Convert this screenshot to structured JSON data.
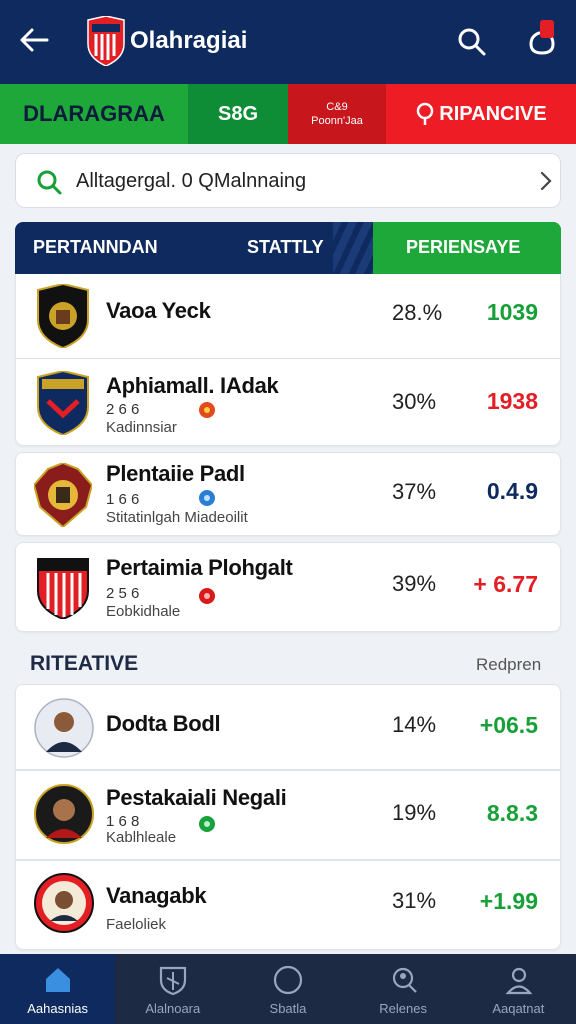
{
  "header": {
    "title": "Olahragiai",
    "icons": [
      "back-arrow-icon",
      "team-crest-logo",
      "search-icon",
      "notification-bell-icon"
    ]
  },
  "banner": {
    "seg1": "DLARAGRAA",
    "seg2": "S8G",
    "seg3_line1": "C&9",
    "seg3_line2": "Poonn'Jaa",
    "seg4": "RIPANCIVE"
  },
  "search": {
    "text": "Alltagergal. 0 QMalnnaing"
  },
  "table_header": {
    "col1": "PERTANNDAN",
    "col2": "STATTLY",
    "col3": "PERIENSAYE"
  },
  "teams": [
    {
      "name": "Vaoa Yeck",
      "stats": "",
      "sub": "",
      "pct": "28.%",
      "value": "1039",
      "value_color": "green"
    },
    {
      "name": "Aphiamall. IAdak",
      "stats": "2 6 6",
      "sub": "Kadinnsiar",
      "pct": "30%",
      "value": "1938",
      "value_color": "red"
    },
    {
      "name": "Plentaiie Padl",
      "stats": "1 6 6",
      "sub": "Stitatinlgah  Miadeoilit",
      "pct": "37%",
      "value": "0.4.9",
      "value_color": "navy"
    },
    {
      "name": "Pertaimia Plohgalt",
      "stats": "2 5 6",
      "sub": "Eobkidhale",
      "pct": "39%",
      "value": "+ 6.77",
      "value_color": "red"
    }
  ],
  "section": {
    "title": "RITEATIVE",
    "link": "Redpren"
  },
  "players": [
    {
      "name": "Dodta Bodl",
      "stats": "",
      "sub": "",
      "pct": "14%",
      "value": "+06.5"
    },
    {
      "name": "Pestakaiali Negali",
      "stats": "1 6 8",
      "sub": "Kablhleale",
      "pct": "19%",
      "value": "8.8.3"
    },
    {
      "name": "Vanagabk",
      "stats": "",
      "sub": "Faeloliek",
      "pct": "31%",
      "value": "+1.99"
    }
  ],
  "bottom_nav": [
    {
      "label": "Aahasnias",
      "icon": "home-icon"
    },
    {
      "label": "Alalnoara",
      "icon": "shield-icon"
    },
    {
      "label": "Sbatla",
      "icon": "circle-icon"
    },
    {
      "label": "Relenes",
      "icon": "search-people-icon"
    },
    {
      "label": "Aaqatnat",
      "icon": "user-icon"
    }
  ],
  "colors": {
    "navy": "#0f2a5e",
    "green": "#1fa83a",
    "red": "#e31e24"
  }
}
